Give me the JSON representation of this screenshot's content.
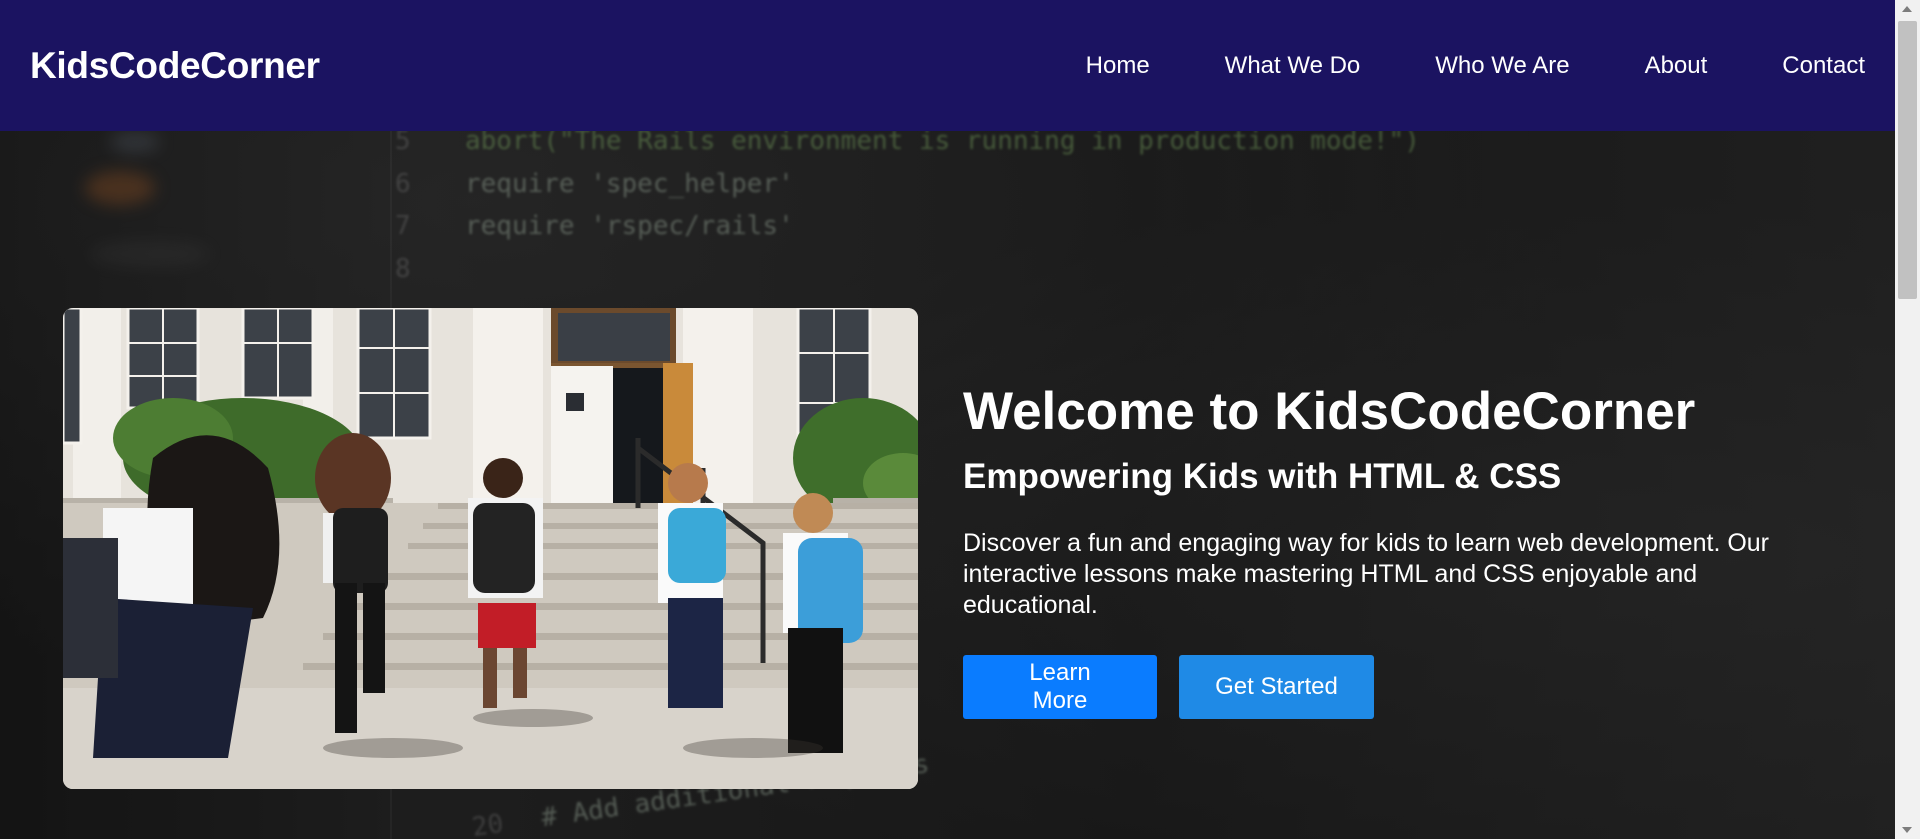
{
  "brand": "KidsCodeCorner",
  "nav": {
    "items": [
      "Home",
      "What We Do",
      "Who We Are",
      "About",
      "Contact"
    ]
  },
  "hero": {
    "title": "Welcome to KidsCodeCorner",
    "subtitle": "Empowering Kids with HTML & CSS",
    "description": "Discover a fun and engaging way for kids to learn web development. Our interactive lessons make mastering HTML and CSS enjoyable and educational.",
    "buttons": {
      "learn_more": "Learn More",
      "get_started": "Get Started"
    },
    "background_code": [
      {
        "num": "5",
        "code": "abort(\"The Rails environment is running in production mode!\")"
      },
      {
        "num": "6",
        "code": "require 'spec_helper'"
      },
      {
        "num": "7",
        "code": "require 'rspec/rails'"
      },
      {
        "num": "8",
        "code": ""
      },
      {
        "num": "20",
        "code": "# Add additional requires"
      }
    ]
  },
  "colors": {
    "navbar": "#1b1361",
    "button_primary": "#0a7cff",
    "button_secondary": "#1f8ae6",
    "hero_bg": "#1c1c1c"
  },
  "icons": {
    "photo": "children-running-to-school-photo"
  }
}
